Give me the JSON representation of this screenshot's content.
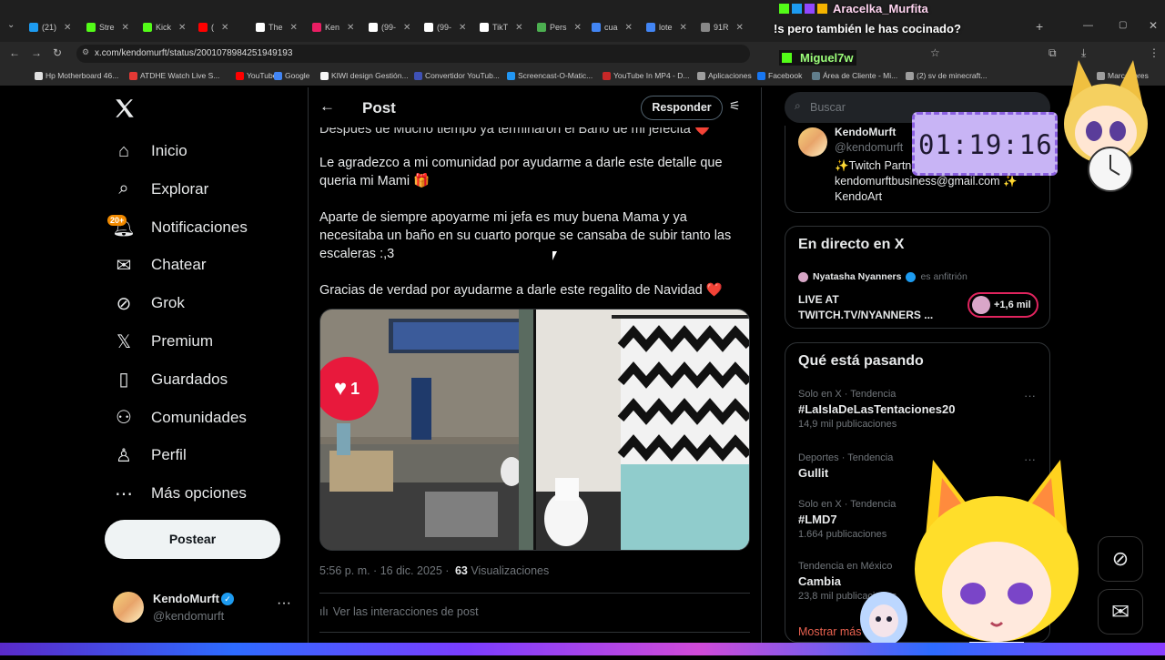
{
  "browser": {
    "tabs": [
      {
        "label": "(21)",
        "color": "#1d9bf0"
      },
      {
        "label": "Stre",
        "color": "#53fc18"
      },
      {
        "label": "Kick",
        "color": "#53fc18"
      },
      {
        "label": "(",
        "color": "#ff0000"
      },
      {
        "label": "The",
        "color": "#ffffff"
      },
      {
        "label": "Ken",
        "color": "#e91e63"
      },
      {
        "label": "(99-",
        "color": "#ffffff"
      },
      {
        "label": "(99-",
        "color": "#ffffff"
      },
      {
        "label": "TikT",
        "color": "#ffffff"
      },
      {
        "label": "Pers",
        "color": "#4caf50"
      },
      {
        "label": "cua",
        "color": "#4285f4"
      },
      {
        "label": "lote",
        "color": "#4285f4"
      },
      {
        "label": "91R",
        "color": "#888888"
      }
    ],
    "url": "x.com/kendomurft/status/2001078984251949193",
    "bookmarks": [
      {
        "label": "Hp Motherboard 46...",
        "color": "#e0e0e0"
      },
      {
        "label": "ATDHE Watch Live S...",
        "color": "#e53935"
      },
      {
        "label": "YouTube",
        "color": "#ff0000"
      },
      {
        "label": "Google",
        "color": "#4285f4"
      },
      {
        "label": "KIWI design Gestión...",
        "color": "#f5f5f5"
      },
      {
        "label": "Convertidor YouTub...",
        "color": "#3f51b5"
      },
      {
        "label": "Screencast-O-Matic...",
        "color": "#2196f3"
      },
      {
        "label": "YouTube In MP4 - D...",
        "color": "#c62828"
      },
      {
        "label": "Aplicaciones",
        "color": "#9e9e9e"
      },
      {
        "label": "Facebook",
        "color": "#1877f2"
      },
      {
        "label": "Área de Cliente - Mi...",
        "color": "#607d8b"
      },
      {
        "label": "(2) sv de minecraft...",
        "color": "#9e9e9e"
      },
      {
        "label": "Marcadores",
        "color": "#9e9e9e"
      }
    ]
  },
  "nav": {
    "items": [
      {
        "label": "Inicio",
        "icon": "home-icon"
      },
      {
        "label": "Explorar",
        "icon": "search-icon"
      },
      {
        "label": "Notificaciones",
        "icon": "bell-icon",
        "badge": "20+"
      },
      {
        "label": "Chatear",
        "icon": "mail-icon"
      },
      {
        "label": "Grok",
        "icon": "grok-icon"
      },
      {
        "label": "Premium",
        "icon": "x-logo-icon"
      },
      {
        "label": "Guardados",
        "icon": "bookmark-icon"
      },
      {
        "label": "Comunidades",
        "icon": "people-icon"
      },
      {
        "label": "Perfil",
        "icon": "person-icon"
      },
      {
        "label": "Más opciones",
        "icon": "more-circle-icon"
      }
    ],
    "post_button": "Postear",
    "account": {
      "name": "KendoMurft",
      "handle": "@kendomurft"
    }
  },
  "post": {
    "header_title": "Post",
    "reply_button": "Responder",
    "paragraphs": [
      "Despues de Mucho tiempo ya terminaron el Baño de mi jefecita ❤️",
      "Le agradezco a mi comunidad por ayudarme a darle este detalle que queria mi Mami 🎁",
      "Aparte de siempre apoyarme mi jefa es muy buena Mama y ya necesitaba un baño en su cuarto porque se cansaba de subir tanto las escaleras :,3",
      "Gracias de verdad por ayudarme a darle este regalito de Navidad ❤️"
    ],
    "timestamp": "5:56 p. m. · 16 dic. 2025 ·",
    "views_count": "63",
    "views_label": "Visualizaciones",
    "interactions_link": "Ver las interacciones de post",
    "like_sticker": "1"
  },
  "sidebar": {
    "search_placeholder": "Buscar",
    "profile_card": {
      "name": "KendoMurft",
      "handle": "@kendomurft",
      "bio_line1": "✨Twitch Partner",
      "bio_line2": "kendomurftbusiness@gmail.com ✨",
      "bio_line3": "KendoArt"
    },
    "live": {
      "title": "En directo en X",
      "host": "Nyatasha Nyanners",
      "host_role": "es anfitrión",
      "stream_title": "LIVE AT TWITCH.TV/NYANNERS ...",
      "listeners": "+1,6 mil"
    },
    "trends": {
      "title": "Qué está pasando",
      "items": [
        {
          "meta": "Solo en X · Tendencia",
          "name": "#LaIslaDeLasTentaciones20",
          "count": "14,9 mil publicaciones"
        },
        {
          "meta": "Deportes · Tendencia",
          "name": "Gullit",
          "count": ""
        },
        {
          "meta": "Solo en X · Tendencia",
          "name": "#LMD7",
          "count": "1.664 publicaciones"
        },
        {
          "meta": "Tendencia en México",
          "name": "Cambia",
          "count": "23,8 mil publicaciones"
        }
      ],
      "show_more": "Mostrar más"
    }
  },
  "stream_overlay": {
    "chat": [
      {
        "user": "Aracelka_Murfita",
        "message": "!s pero también le has cocinado?"
      },
      {
        "user": "Miguel7w",
        "message": ""
      }
    ],
    "timer": "01:19:16"
  },
  "colors": {
    "accent": "#1d9bf0",
    "notif_badge": "#f18a00",
    "live_pill": "#e0245e",
    "timer_bg": "#c8b4f5"
  }
}
